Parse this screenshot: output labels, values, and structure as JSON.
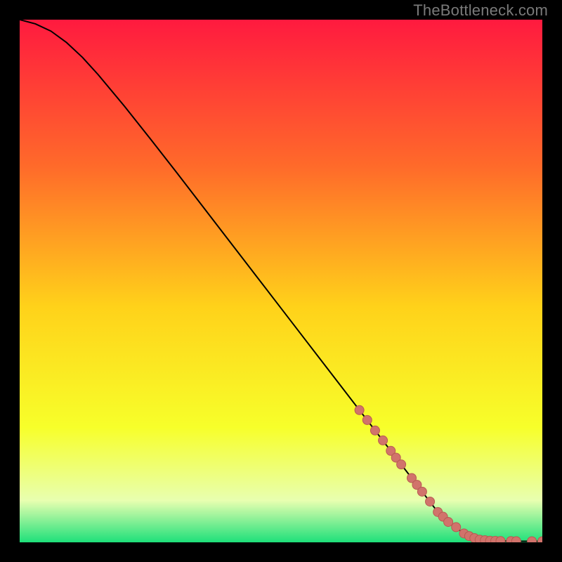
{
  "attribution": "TheBottleneck.com",
  "colors": {
    "page_bg": "#000000",
    "attribution_text": "#7a7a7a",
    "gradient_top": "#ff1a3f",
    "gradient_upper_mid": "#ff6a2a",
    "gradient_mid": "#ffd21a",
    "gradient_lower_mid": "#f7ff2a",
    "gradient_pale": "#e8ffb0",
    "gradient_bottom": "#1ee07a",
    "curve": "#000000",
    "marker_fill": "#d1736b",
    "marker_stroke": "#b85a52"
  },
  "chart_data": {
    "type": "line",
    "title": "",
    "xlabel": "",
    "ylabel": "",
    "xlim": [
      0,
      100
    ],
    "ylim": [
      0,
      100
    ],
    "series": [
      {
        "name": "bottleneck-curve",
        "x": [
          0,
          3,
          6,
          9,
          12,
          15,
          20,
          25,
          30,
          35,
          40,
          45,
          50,
          55,
          60,
          65,
          70,
          75,
          80,
          83,
          86,
          88,
          90,
          93,
          96,
          100
        ],
        "y": [
          100,
          99.2,
          97.8,
          95.6,
          92.8,
          89.5,
          83.5,
          77.2,
          70.8,
          64.3,
          57.8,
          51.3,
          44.8,
          38.3,
          31.8,
          25.3,
          18.8,
          12.3,
          5.8,
          3.0,
          1.2,
          0.5,
          0.3,
          0.25,
          0.2,
          0.2
        ]
      }
    ],
    "markers": {
      "name": "highlighted-points",
      "x": [
        65,
        66.5,
        68,
        69.5,
        71,
        72,
        73,
        75,
        76,
        77,
        78.5,
        80,
        81,
        82,
        83.5,
        85,
        86,
        87,
        88,
        89,
        90,
        91,
        92,
        94,
        95,
        98,
        100
      ],
      "y": [
        25.3,
        23.4,
        21.4,
        19.5,
        17.5,
        16.2,
        14.9,
        12.3,
        11.0,
        9.7,
        7.8,
        5.8,
        4.9,
        3.9,
        2.9,
        1.7,
        1.2,
        0.8,
        0.5,
        0.4,
        0.3,
        0.28,
        0.26,
        0.24,
        0.22,
        0.2,
        0.2
      ]
    }
  }
}
